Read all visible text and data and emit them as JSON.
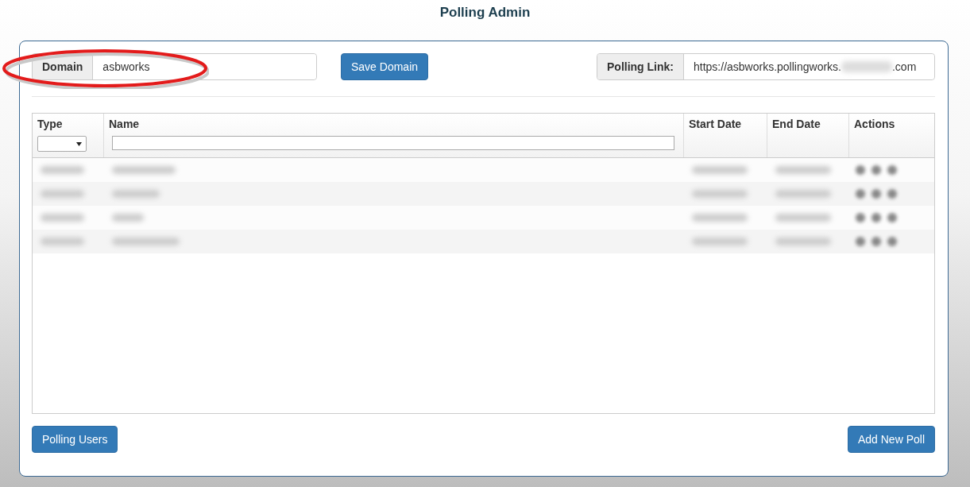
{
  "title": "Polling Admin",
  "domain": {
    "label": "Domain",
    "value": "asbworks",
    "highlight": {
      "kind": "ellipse"
    }
  },
  "save_button": "Save Domain",
  "polling_link": {
    "label": "Polling Link:",
    "value_start": "https://asbworks.pollingworks.",
    "value_end": ".com",
    "redacted": true
  },
  "table": {
    "columns": [
      {
        "label": "Type",
        "kind": "select"
      },
      {
        "label": "Name",
        "kind": "text"
      },
      {
        "label": "Start Date",
        "kind": "plain"
      },
      {
        "label": "End Date",
        "kind": "plain"
      },
      {
        "label": "Actions",
        "kind": "plain"
      }
    ],
    "rows": [
      {
        "redacted": true
      },
      {
        "redacted": true
      },
      {
        "redacted": true
      },
      {
        "redacted": true
      }
    ]
  },
  "footer_buttons": [
    "Polling Users",
    "Add New Poll"
  ]
}
